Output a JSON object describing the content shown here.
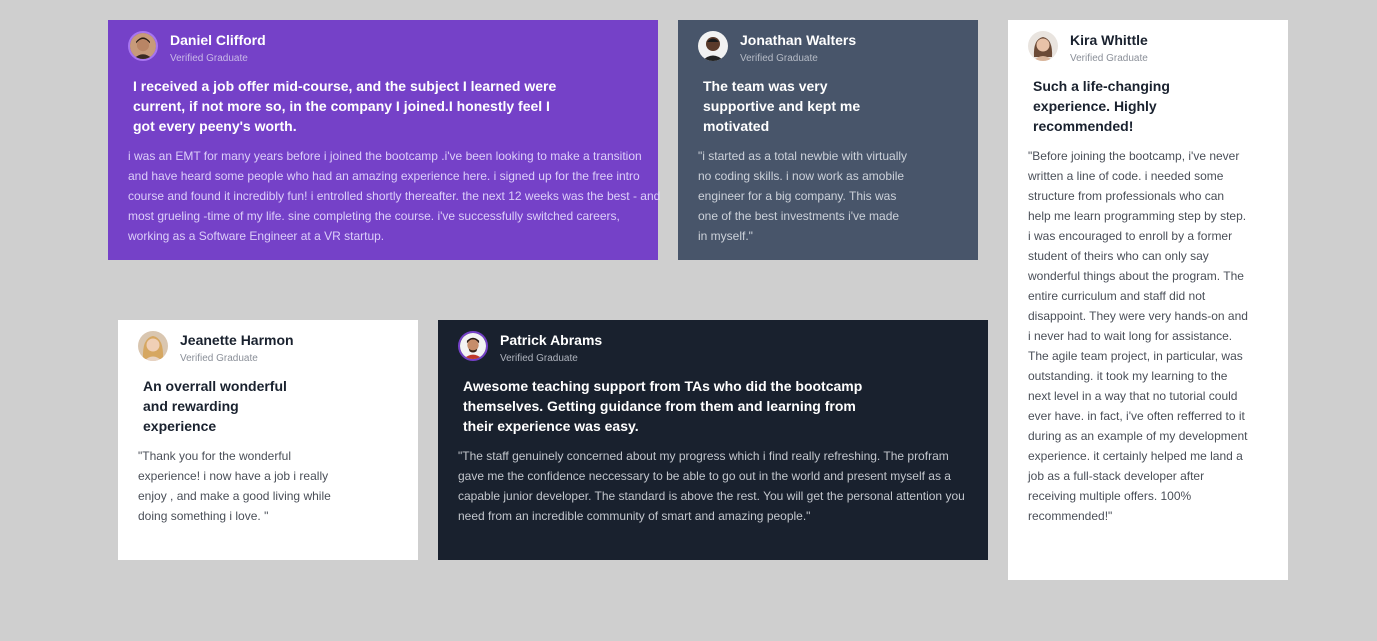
{
  "testimonials": [
    {
      "name": "Daniel Clifford",
      "role": "Verified Graduate",
      "headline": "I received a job offer mid-course, and the subject I learned were current, if not more so, in the company I joined.I honestly feel I got every peeny's worth.",
      "body": "i was an EMT for many years before i joined the bootcamp .i've been looking to make a transition and have heard some people who had an amazing experience here. i signed up for the free intro course and found it incredibly fun! i entrolled shortly thereafter. the next 12 weeks was the best - and most grueling -time of my life. sine completing the course. i've successfully switched careers, working as a Software Engineer at a VR startup.",
      "theme": "#7541c8",
      "avatar_icon": "avatar-daniel-icon"
    },
    {
      "name": "Jonathan Walters",
      "role": "Verified Graduate",
      "headline": "The team was very supportive and kept me motivated",
      "body": "\"i started as a total newbie with virtually no coding skills. i now work as amobile engineer for a big company. This was one of the best investments i've made in myself.\"",
      "theme": "#48556a",
      "avatar_icon": "avatar-jonathan-icon"
    },
    {
      "name": "Kira Whittle",
      "role": "Verified Graduate",
      "headline": "Such a life-changing experience. Highly recommended!",
      "body": "\"Before joining the bootcamp, i've never written a line of code. i needed some structure from professionals who can help me learn programming step by step. i was encouraged to enroll by a former student of theirs who can only say wonderful things about the program. The entire curriculum and staff did not disappoint. They were very hands-on and i never had to wait long for assistance. The agile team project, in particular, was outstanding. it took my learning to the next level in a way that no tutorial could ever have. in fact, i've often refferred to it during as an example of my development experience. it certainly helped me land a job as a full-stack developer after receiving multiple offers. 100% recommended!\"",
      "theme": "#ffffff",
      "avatar_icon": "avatar-kira-icon"
    },
    {
      "name": "Jeanette Harmon",
      "role": "Verified Graduate",
      "headline": "An overrall wonderful and rewarding experience",
      "body": "\"Thank you for the wonderful experience! i now have a job i really enjoy , and make a good living while doing something i love. \"",
      "theme": "#ffffff",
      "avatar_icon": "avatar-jeanette-icon"
    },
    {
      "name": "Patrick Abrams",
      "role": "Verified Graduate",
      "headline": "Awesome teaching support from TAs who did the bootcamp themselves. Getting guidance from them and learning from their experience was easy.",
      "body": "\"The staff genuinely concerned about my progress which i find really refreshing. The profram gave me the confidence neccessary to be able to go out in the world and present myself as a capable junior developer. The standard is above the rest. You will get the personal attention you need from an incredible community of smart and amazing people.\"",
      "theme": "#19212e",
      "avatar_icon": "avatar-patrick-icon"
    }
  ]
}
